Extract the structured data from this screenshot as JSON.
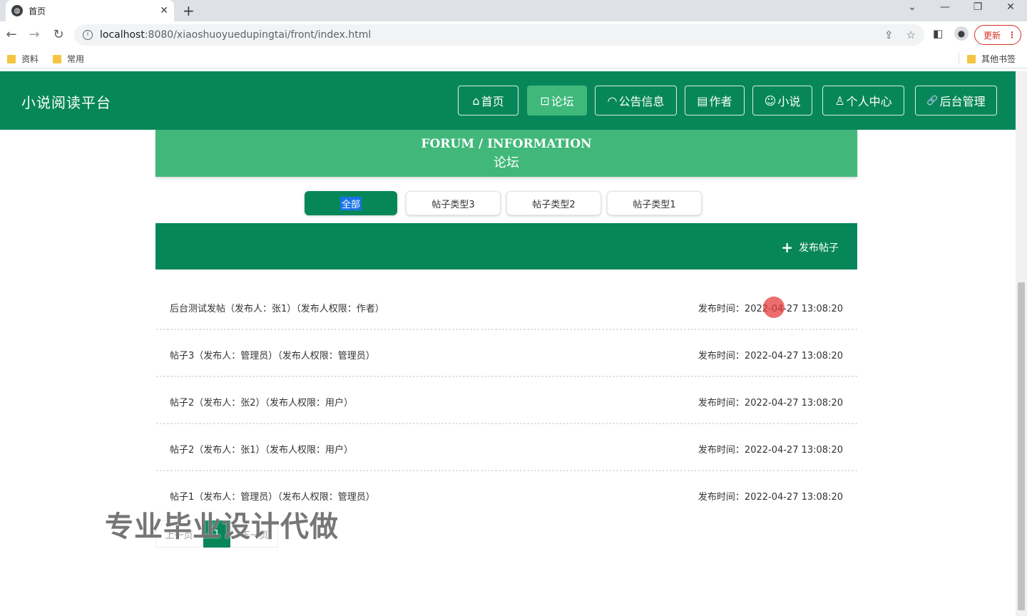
{
  "browser": {
    "tab_title": "首页",
    "tab_close": "✕",
    "new_tab": "+",
    "url_host": "localhost",
    "url_rest": ":8080/xiaoshuoyuedupingtai/front/index.html",
    "update_label": "更新",
    "bookmarks": [
      "资料",
      "常用"
    ],
    "other_bookmarks": "其他书签"
  },
  "site": {
    "brand": "小说阅读平台",
    "nav": [
      {
        "icon": "⌂",
        "label": "首页"
      },
      {
        "icon": "⊡",
        "label": "论坛"
      },
      {
        "icon": "◠",
        "label": "公告信息"
      },
      {
        "icon": "▤",
        "label": "作者"
      },
      {
        "icon": "☺",
        "label": "小说"
      },
      {
        "icon": "♙",
        "label": "个人中心"
      },
      {
        "icon": "🔗",
        "label": "后台管理"
      }
    ],
    "active_nav": "论坛"
  },
  "banner": {
    "en": "FORUM / INFORMATION",
    "cn": "论坛"
  },
  "filters": [
    "全部",
    "帖子类型3",
    "帖子类型2",
    "帖子类型1"
  ],
  "active_filter": "全部",
  "post_button": "发布帖子",
  "time_label": "发布时间：",
  "posts": [
    {
      "title": "后台测试发帖（发布人：张1）（发布人权限：作者）",
      "time": "2022-04-27 13:08:20"
    },
    {
      "title": "帖子3（发布人：管理员）（发布人权限：管理员）",
      "time": "2022-04-27 13:08:20"
    },
    {
      "title": "帖子2（发布人：张2）（发布人权限：用户）",
      "time": "2022-04-27 13:08:20"
    },
    {
      "title": "帖子2（发布人：张1）（发布人权限：用户）",
      "time": "2022-04-27 13:08:20"
    },
    {
      "title": "帖子1（发布人：管理员）（发布人权限：管理员）",
      "time": "2022-04-27 13:08:20"
    }
  ],
  "pagination": {
    "prev": "上一页",
    "current": "1",
    "next": "下一页"
  },
  "watermark": "专业毕业设计代做"
}
